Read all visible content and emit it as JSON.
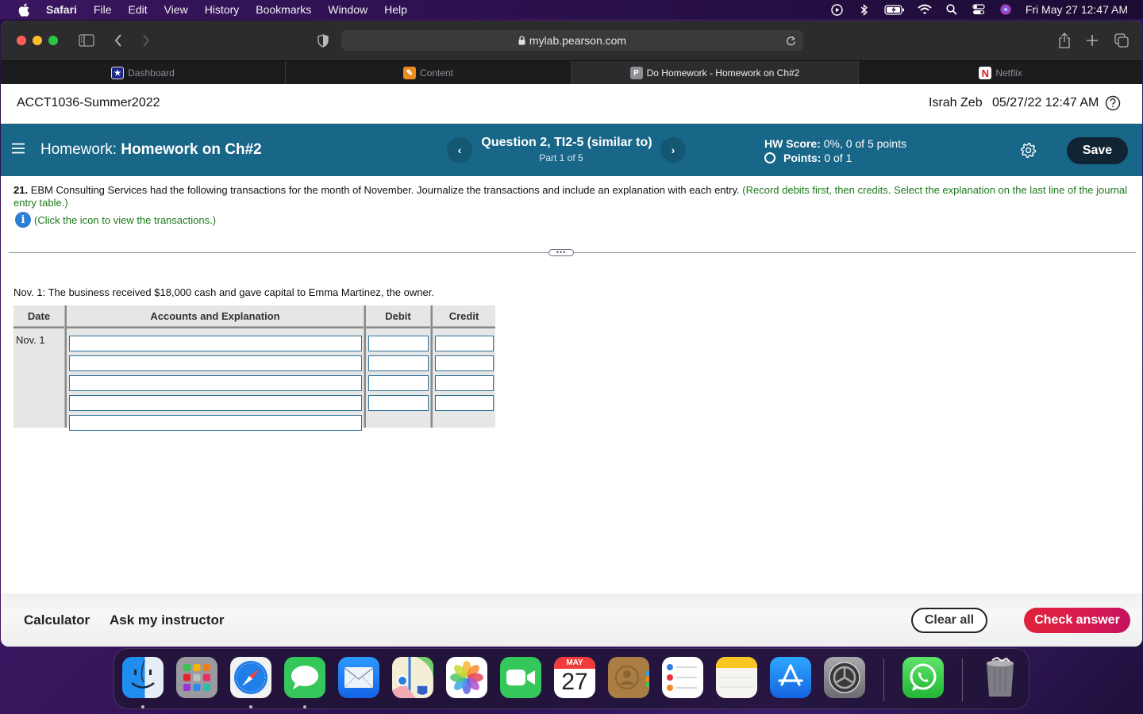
{
  "menubar": {
    "app_name": "Safari",
    "items": [
      "File",
      "Edit",
      "View",
      "History",
      "Bookmarks",
      "Window",
      "Help"
    ],
    "status_icons": [
      "play-circle-icon",
      "bluetooth-icon",
      "battery-charging-icon",
      "wifi-icon",
      "spotlight-search-icon",
      "control-center-icon",
      "siri-icon"
    ],
    "clock": "Fri May 27  12:47 AM"
  },
  "browser": {
    "url": "mylab.pearson.com",
    "tabs": [
      {
        "label": "Dashboard",
        "favicon": "★",
        "active": false
      },
      {
        "label": "Content",
        "favicon": "✎",
        "active": false
      },
      {
        "label": "Do Homework - Homework on Ch#2",
        "favicon": "P",
        "active": true
      },
      {
        "label": "Netflix",
        "favicon": "N",
        "active": false
      }
    ]
  },
  "course": {
    "title": "ACCT1036-Summer2022",
    "user": "Israh Zeb",
    "datetime": "05/27/22 12:47 AM"
  },
  "homework_bar": {
    "label_prefix": "Homework:",
    "label_name": "Homework on Ch#2",
    "question_title": "Question 2, TI2-5 (similar to)",
    "question_part": "Part 1 of 5",
    "prev_label": "‹",
    "next_label": "›",
    "hw_score_label": "HW Score:",
    "hw_score_value": "0%, 0 of 5 points",
    "points_label": "Points:",
    "points_value": "0 of 1",
    "save_label": "Save",
    "colors": {
      "bar": "#186688",
      "save_button": "#112433"
    }
  },
  "question": {
    "number": "21.",
    "text": "EBM Consulting Services had the following transactions for the month of November. Journalize the transactions and include an explanation with each entry.",
    "instruction": "(Record debits first, then credits. Select the explanation on the last line of the journal entry table.)",
    "info_text": "(Click the icon to view the transactions.)"
  },
  "transaction": {
    "text": "Nov. 1: The business received $18,000 cash and gave capital to Emma Martinez, the owner."
  },
  "journal": {
    "headers": [
      "Date",
      "Accounts and Explanation",
      "Debit",
      "Credit"
    ],
    "date": "Nov. 1",
    "rows": [
      {
        "account": "",
        "debit": "",
        "credit": ""
      },
      {
        "account": "",
        "debit": "",
        "credit": ""
      },
      {
        "account": "",
        "debit": "",
        "credit": ""
      },
      {
        "account": "",
        "debit": "",
        "credit": ""
      },
      {
        "account": ""
      }
    ]
  },
  "footer": {
    "calculator": "Calculator",
    "ask_instructor": "Ask my instructor",
    "clear_all": "Clear all",
    "check_answer": "Check answer",
    "colors": {
      "check_answer": "#dc1e45"
    }
  },
  "dock": {
    "apps": [
      "Finder",
      "Launchpad",
      "Safari",
      "Messages",
      "Mail",
      "Maps",
      "Photos",
      "FaceTime",
      "Calendar",
      "Contacts",
      "Reminders",
      "Notes",
      "App Store",
      "System Preferences",
      "WhatsApp",
      "Trash"
    ],
    "calendar_month": "MAY",
    "calendar_day": "27"
  }
}
